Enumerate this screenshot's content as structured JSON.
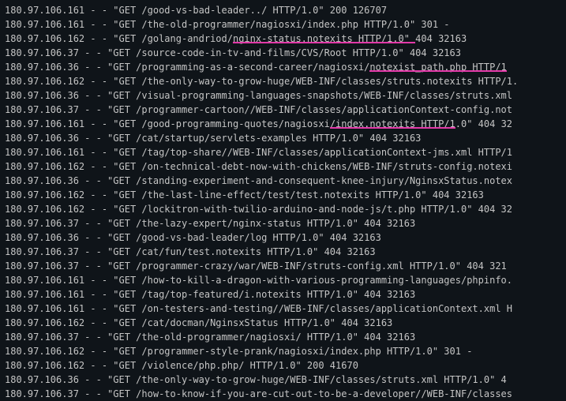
{
  "log": [
    {
      "t": "180.97.106.161 - - \"GET /good-vs-bad-leader../ HTTP/1.0\" 200 126707"
    },
    {
      "t": "180.97.106.161 - - \"GET /the-old-programmer/nagiosxi/index.php HTTP/1.0\" 301 -"
    },
    {
      "pre": "180.97.106.162 - - \"GET /golang-andriod/",
      "hl": "nginx-status.notexits HTTP/1.0\" ",
      "post": "404 32163"
    },
    {
      "t": "180.97.106.37 - - \"GET /source-code-in-tv-and-films/CVS/Root HTTP/1.0\" 404 32163"
    },
    {
      "pre": "180.97.106.36 - - \"GET /programming-as-a-second-career/nagiosxi/",
      "hl": "notexist_path.php HTTP/1",
      "post": ""
    },
    {
      "t": "180.97.106.162 - - \"GET /the-only-way-to-grow-huge/WEB-INF/classes/struts.notexits HTTP/1."
    },
    {
      "t": "180.97.106.36 - - \"GET /visual-programming-languages-snapshots/WEB-INF/classes/struts.xml"
    },
    {
      "t": "180.97.106.37 - - \"GET /programmer-cartoon//WEB-INF/classes/applicationContext-config.not"
    },
    {
      "pre": "180.97.106.161 - - \"GET /good-programming-quotes/nagiosxi",
      "hl": "/index.notexits HTTP/1",
      "post": ".0\" 404 32"
    },
    {
      "t": "180.97.106.36 - - \"GET /cat/startup/servlets-examples HTTP/1.0\" 404 32163"
    },
    {
      "t": "180.97.106.161 - - \"GET /tag/top-share//WEB-INF/classes/applicationContext-jms.xml HTTP/1"
    },
    {
      "t": "180.97.106.162 - - \"GET /on-technical-debt-now-with-chickens/WEB-INF/struts-config.notexi"
    },
    {
      "t": "180.97.106.36 - - \"GET /standing-experiment-and-consequent-knee-injury/NginsxStatus.notex"
    },
    {
      "t": "180.97.106.162 - - \"GET /the-last-line-effect/test/test.notexits HTTP/1.0\" 404 32163"
    },
    {
      "t": "180.97.106.162 - - \"GET /lockitron-with-twilio-arduino-and-node-js/t.php HTTP/1.0\" 404 32"
    },
    {
      "t": "180.97.106.37 - - \"GET /the-lazy-expert/nginx-status HTTP/1.0\" 404 32163"
    },
    {
      "t": "180.97.106.36 - - \"GET /good-vs-bad-leader/log HTTP/1.0\" 404 32163"
    },
    {
      "t": "180.97.106.37 - - \"GET /cat/fun/test.notexits HTTP/1.0\" 404 32163"
    },
    {
      "t": "180.97.106.37 - - \"GET /programmer-crazy/war/WEB-INF/struts-config.xml HTTP/1.0\" 404 321"
    },
    {
      "t": "180.97.106.161 - - \"GET /how-to-kill-a-dragon-with-various-programming-languages/phpinfo."
    },
    {
      "t": "180.97.106.161 - - \"GET /tag/top-featured/i.notexits HTTP/1.0\" 404 32163"
    },
    {
      "t": "180.97.106.161 - - \"GET /on-testers-and-testing//WEB-INF/classes/applicationContext.xml H"
    },
    {
      "t": "180.97.106.162 - - \"GET /cat/docman/NginsxStatus HTTP/1.0\" 404 32163"
    },
    {
      "t": "180.97.106.37 - - \"GET /the-old-programmer/nagiosxi/ HTTP/1.0\" 404 32163"
    },
    {
      "t": "180.97.106.162 - - \"GET /programmer-style-prank/nagiosxi/index.php HTTP/1.0\" 301 -"
    },
    {
      "t": "180.97.106.162 - - \"GET /violence/php.php/ HTTP/1.0\" 200 41670"
    },
    {
      "t": "180.97.106.36 - - \"GET /the-only-way-to-grow-huge/WEB-INF/classes/struts.xml HTTP/1.0\" 4"
    },
    {
      "t": "180.97.106.37 - - \"GET /how-to-know-if-you-are-cut-out-to-be-a-developer//WEB-INF/classes"
    }
  ]
}
